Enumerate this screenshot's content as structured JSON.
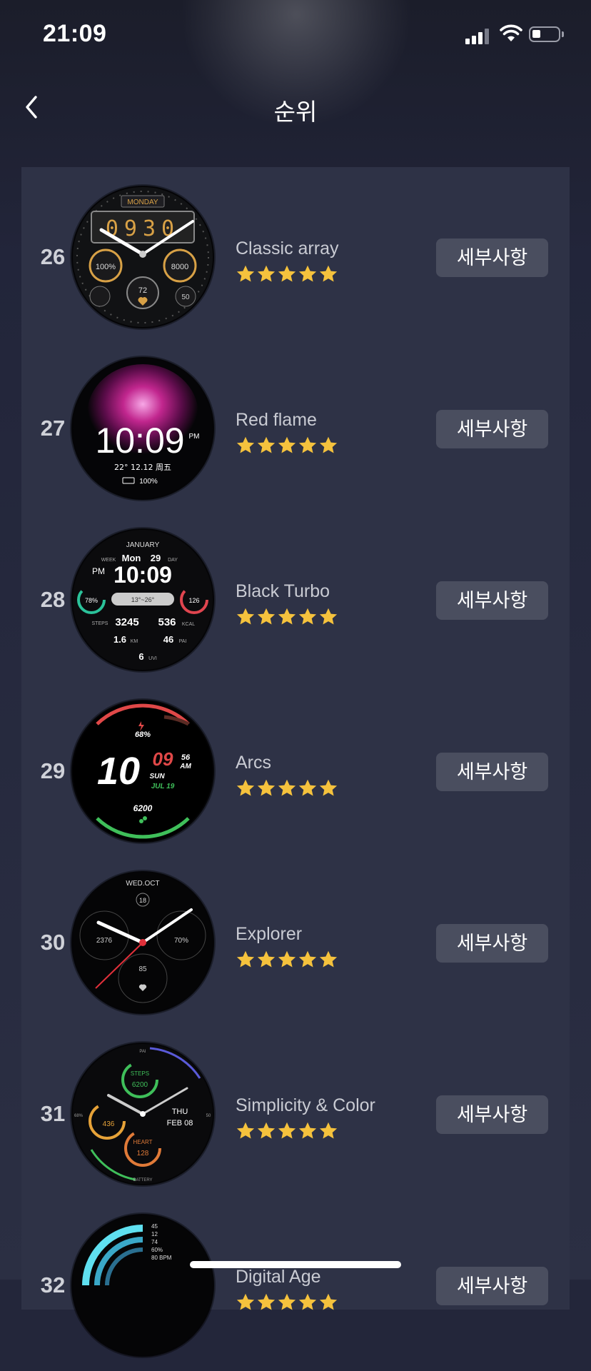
{
  "status_bar": {
    "time": "21:09",
    "battery_level": 0.25
  },
  "header": {
    "title": "순위",
    "back_icon": "chevron-left-icon"
  },
  "detail_label": "세부사항",
  "items": [
    {
      "rank": "26",
      "name": "Classic array",
      "rating": 5,
      "face": {
        "texts": [
          "MONDAY",
          "0930",
          "100%",
          "8000",
          "72",
          "50"
        ],
        "accent": "#d8a146"
      }
    },
    {
      "rank": "27",
      "name": "Red flame",
      "rating": 5,
      "face": {
        "time": "10:09",
        "ampm": "PM",
        "info": "22° 12.12 周五",
        "battery": "100%"
      }
    },
    {
      "rank": "28",
      "name": "Black Turbo",
      "rating": 5,
      "face": {
        "month": "JANUARY",
        "week": "WEEK",
        "day_name": "Mon",
        "day_num": "29",
        "day_label": "DAY",
        "ampm": "PM",
        "time": "10:09",
        "pct": "78%",
        "temp": "13°~26°",
        "heart": "126",
        "steps_label": "STEPS",
        "steps": "3245",
        "kcal": "536",
        "kcal_label": "KCAL",
        "km": "1.6",
        "km_label": "KM",
        "pai": "46",
        "pai_label": "PAI",
        "uvi": "6",
        "uvi_label": "UVI"
      }
    },
    {
      "rank": "29",
      "name": "Arcs",
      "rating": 5,
      "face": {
        "battery": "68%",
        "hour": "10",
        "minute": "09",
        "second": "56",
        "ampm": "AM",
        "weekday": "SUN",
        "date": "JUL 19",
        "steps": "6200"
      }
    },
    {
      "rank": "30",
      "name": "Explorer",
      "rating": 5,
      "face": {
        "date": "WED.OCT",
        "day": "18",
        "steps": "2376",
        "battery": "70%",
        "heart": "85"
      }
    },
    {
      "rank": "31",
      "name": "Simplicity & Color",
      "rating": 5,
      "face": {
        "steps_label": "STEPS",
        "steps": "6200",
        "cal": "436",
        "heart_label": "HEART",
        "heart": "128",
        "weekday": "THU",
        "date": "FEB 08",
        "left": "68%",
        "right": "50",
        "top": "PAI",
        "bottom": "BATTERY"
      }
    },
    {
      "rank": "32",
      "name": "Digital Age",
      "rating": 5,
      "face": {
        "stats": [
          "45",
          "12",
          "74",
          "60%",
          "80 BPM"
        ]
      }
    }
  ],
  "colors": {
    "star": "#f5c23d",
    "button_bg": "#4a4e5f",
    "panel_bg": "#2e3246"
  }
}
